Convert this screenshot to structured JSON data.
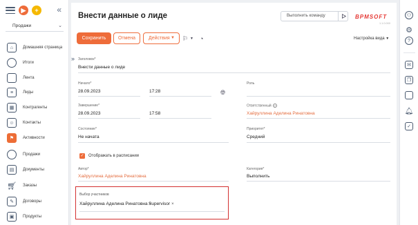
{
  "sidebar": {
    "workspace": "Продажи",
    "items": [
      {
        "label": "Домашняя страница",
        "icon": "home-icon"
      },
      {
        "label": "Итоги",
        "icon": "pie-chart-icon"
      },
      {
        "label": "Лента",
        "icon": "chat-icon"
      },
      {
        "label": "Лиды",
        "icon": "lead-icon"
      },
      {
        "label": "Контрагенты",
        "icon": "building-icon"
      },
      {
        "label": "Контакты",
        "icon": "contact-card-icon"
      },
      {
        "label": "Активности",
        "icon": "flag-icon"
      },
      {
        "label": "Продажи",
        "icon": "sales-icon"
      },
      {
        "label": "Документы",
        "icon": "document-icon"
      },
      {
        "label": "Заказы",
        "icon": "cart-icon"
      },
      {
        "label": "Договоры",
        "icon": "contract-icon"
      },
      {
        "label": "Продукты",
        "icon": "product-icon"
      }
    ],
    "active_item": "Активности",
    "accent": "#ed6d36"
  },
  "header": {
    "title": "Внести данные о лиде",
    "command_placeholder": "Выполнить команду",
    "logo": "BPMSOFT",
    "version": "1.1.0.000"
  },
  "toolbar": {
    "save_label": "Сохранить",
    "cancel_label": "Отмена",
    "actions_label": "Действия",
    "view_settings_label": "Настройка вида"
  },
  "form": {
    "subject": {
      "label": "Заголовок*",
      "value": "Внести данные о лиде"
    },
    "start": {
      "label": "Начало*",
      "date": "28.09.2023",
      "time": "17:28"
    },
    "role": {
      "label": "Роль",
      "value": ""
    },
    "end": {
      "label": "Завершение*",
      "date": "28.09.2023",
      "time": "17:58"
    },
    "responsible": {
      "label": "Ответственный",
      "value": "Хайруллина Аделина Ринатовна"
    },
    "status": {
      "label": "Состояние*",
      "value": "Не начата"
    },
    "priority": {
      "label": "Приоритет*",
      "value": "Средний"
    },
    "show_in_schedule": {
      "label": "Отображать в расписании",
      "checked": true
    },
    "author": {
      "label": "Автор*",
      "value": "Хайруллина Аделина Ринатовна"
    },
    "category": {
      "label": "Категория*",
      "value": "Выполнить"
    },
    "participants": {
      "label": "Выбор участников",
      "chips": [
        "Хайруллина Аделина Ринатовна",
        "Supervisor"
      ],
      "highlight_color": "#d32f2f"
    }
  }
}
